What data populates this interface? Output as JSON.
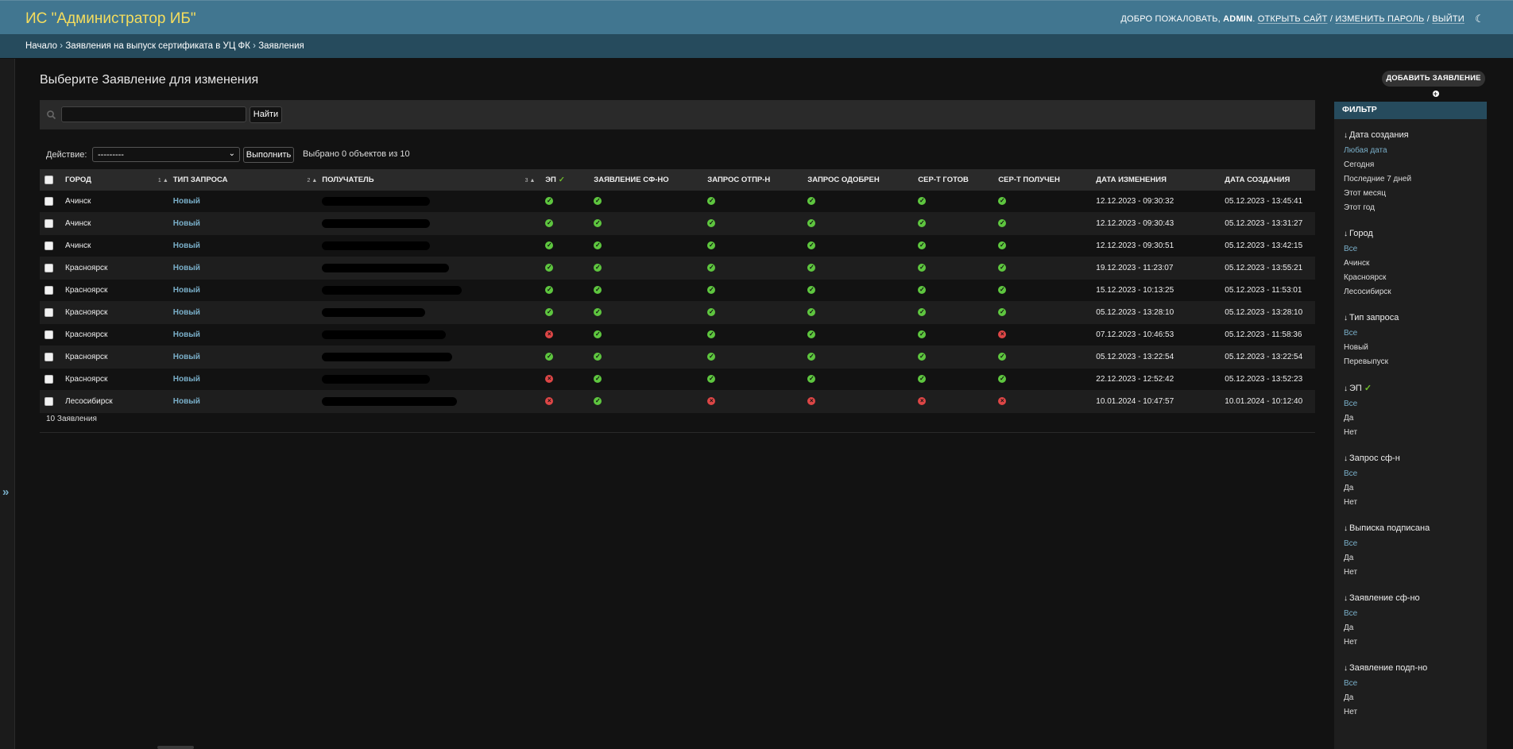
{
  "header": {
    "site_name": "ИС \"Администратор ИБ\"",
    "welcome": "ДОБРО ПОЖАЛОВАТЬ,",
    "username": "ADMIN",
    "view_site": "ОТКРЫТЬ САЙТ",
    "change_password": "ИЗМЕНИТЬ ПАРОЛЬ",
    "logout": "ВЫЙТИ",
    "separator": "/",
    "theme_icon": "moon-icon"
  },
  "breadcrumbs": {
    "home": "Начало",
    "sep": "›",
    "app": "Заявления на выпуск сертификата в УЦ ФК",
    "current": "Заявления"
  },
  "page": {
    "title": "Выберите Заявление для изменения",
    "add_button": "ДОБАВИТЬ ЗАЯВЛЕНИЕ"
  },
  "search": {
    "value": "",
    "button": "Найти"
  },
  "actions": {
    "label": "Действие:",
    "selected": "---------",
    "go": "Выполнить",
    "counter": "Выбрано 0 объектов из 10"
  },
  "table": {
    "columns": [
      {
        "label": "ГОРОД",
        "sort": "1"
      },
      {
        "label": "ТИП ЗАПРОСА",
        "sort": "2"
      },
      {
        "label": "ПОЛУЧАТЕЛЬ",
        "sort": "3"
      },
      {
        "label": "ЭП"
      },
      {
        "label": "ЗАЯВЛЕНИЕ СФ-НО"
      },
      {
        "label": "ЗАПРОС ОТПР-Н"
      },
      {
        "label": "ЗАПРОС ОДОБРЕН"
      },
      {
        "label": "СЕР-Т ГОТОВ"
      },
      {
        "label": "СЕР-Т ПОЛУЧЕН"
      },
      {
        "label": "ДАТА ИЗМЕНЕНИЯ"
      },
      {
        "label": "ДАТА СОЗДАНИЯ"
      }
    ],
    "rows": [
      {
        "city": "Ачинск",
        "type": "Новый",
        "ep": true,
        "sfno": true,
        "sent": true,
        "approved": true,
        "ready": true,
        "received": true,
        "modified": "12.12.2023 - 09:30:32",
        "created": "05.12.2023 - 13:45:41"
      },
      {
        "city": "Ачинск",
        "type": "Новый",
        "ep": true,
        "sfno": true,
        "sent": true,
        "approved": true,
        "ready": true,
        "received": true,
        "modified": "12.12.2023 - 09:30:43",
        "created": "05.12.2023 - 13:31:27"
      },
      {
        "city": "Ачинск",
        "type": "Новый",
        "ep": true,
        "sfno": true,
        "sent": true,
        "approved": true,
        "ready": true,
        "received": true,
        "modified": "12.12.2023 - 09:30:51",
        "created": "05.12.2023 - 13:42:15"
      },
      {
        "city": "Красноярск",
        "type": "Новый",
        "ep": true,
        "sfno": true,
        "sent": true,
        "approved": true,
        "ready": true,
        "received": true,
        "modified": "19.12.2023 - 11:23:07",
        "created": "05.12.2023 - 13:55:21"
      },
      {
        "city": "Красноярск",
        "type": "Новый",
        "ep": true,
        "sfno": true,
        "sent": true,
        "approved": true,
        "ready": true,
        "received": true,
        "modified": "15.12.2023 - 10:13:25",
        "created": "05.12.2023 - 11:53:01"
      },
      {
        "city": "Красноярск",
        "type": "Новый",
        "ep": true,
        "sfno": true,
        "sent": true,
        "approved": true,
        "ready": true,
        "received": true,
        "modified": "05.12.2023 - 13:28:10",
        "created": "05.12.2023 - 13:28:10"
      },
      {
        "city": "Красноярск",
        "type": "Новый",
        "ep": false,
        "sfno": true,
        "sent": true,
        "approved": true,
        "ready": true,
        "received": false,
        "modified": "07.12.2023 - 10:46:53",
        "created": "05.12.2023 - 11:58:36"
      },
      {
        "city": "Красноярск",
        "type": "Новый",
        "ep": true,
        "sfno": true,
        "sent": true,
        "approved": true,
        "ready": true,
        "received": true,
        "modified": "05.12.2023 - 13:22:54",
        "created": "05.12.2023 - 13:22:54"
      },
      {
        "city": "Красноярск",
        "type": "Новый",
        "ep": false,
        "sfno": true,
        "sent": true,
        "approved": true,
        "ready": true,
        "received": true,
        "modified": "22.12.2023 - 12:52:42",
        "created": "05.12.2023 - 13:52:23"
      },
      {
        "city": "Лесосибирск",
        "type": "Новый",
        "ep": false,
        "sfno": true,
        "sent": false,
        "approved": false,
        "ready": false,
        "received": false,
        "modified": "10.01.2024 - 10:47:57",
        "created": "10.01.2024 - 10:12:40"
      }
    ],
    "footer": "10 Заявления"
  },
  "filter": {
    "title": "ФИЛЬТР",
    "groups": [
      {
        "title": "Дата создания",
        "items": [
          "Любая дата",
          "Сегодня",
          "Последние 7 дней",
          "Этот месяц",
          "Этот год"
        ],
        "selected": 0
      },
      {
        "title": "Город",
        "items": [
          "Все",
          "Ачинск",
          "Красноярск",
          "Лесосибирск"
        ],
        "selected": 0
      },
      {
        "title": "Тип запроса",
        "items": [
          "Все",
          "Новый",
          "Перевыпуск"
        ],
        "selected": 0
      },
      {
        "title": "ЭП",
        "check": true,
        "items": [
          "Все",
          "Да",
          "Нет"
        ],
        "selected": 0
      },
      {
        "title": "Запрос сф-н",
        "items": [
          "Все",
          "Да",
          "Нет"
        ],
        "selected": 0
      },
      {
        "title": "Выписка подписана",
        "items": [
          "Все",
          "Да",
          "Нет"
        ],
        "selected": 0
      },
      {
        "title": "Заявление сф-но",
        "items": [
          "Все",
          "Да",
          "Нет"
        ],
        "selected": 0
      },
      {
        "title": "Заявление подп-но",
        "items": [
          "Все",
          "Да",
          "Нет"
        ],
        "selected": 0
      }
    ]
  },
  "colors": {
    "header_bg": "#417690",
    "breadcrumbs_bg": "#264b5d",
    "site_name": "#f5dd5d",
    "link": "#79aec8",
    "yes": "#5ec63f",
    "no": "#dd4646"
  }
}
